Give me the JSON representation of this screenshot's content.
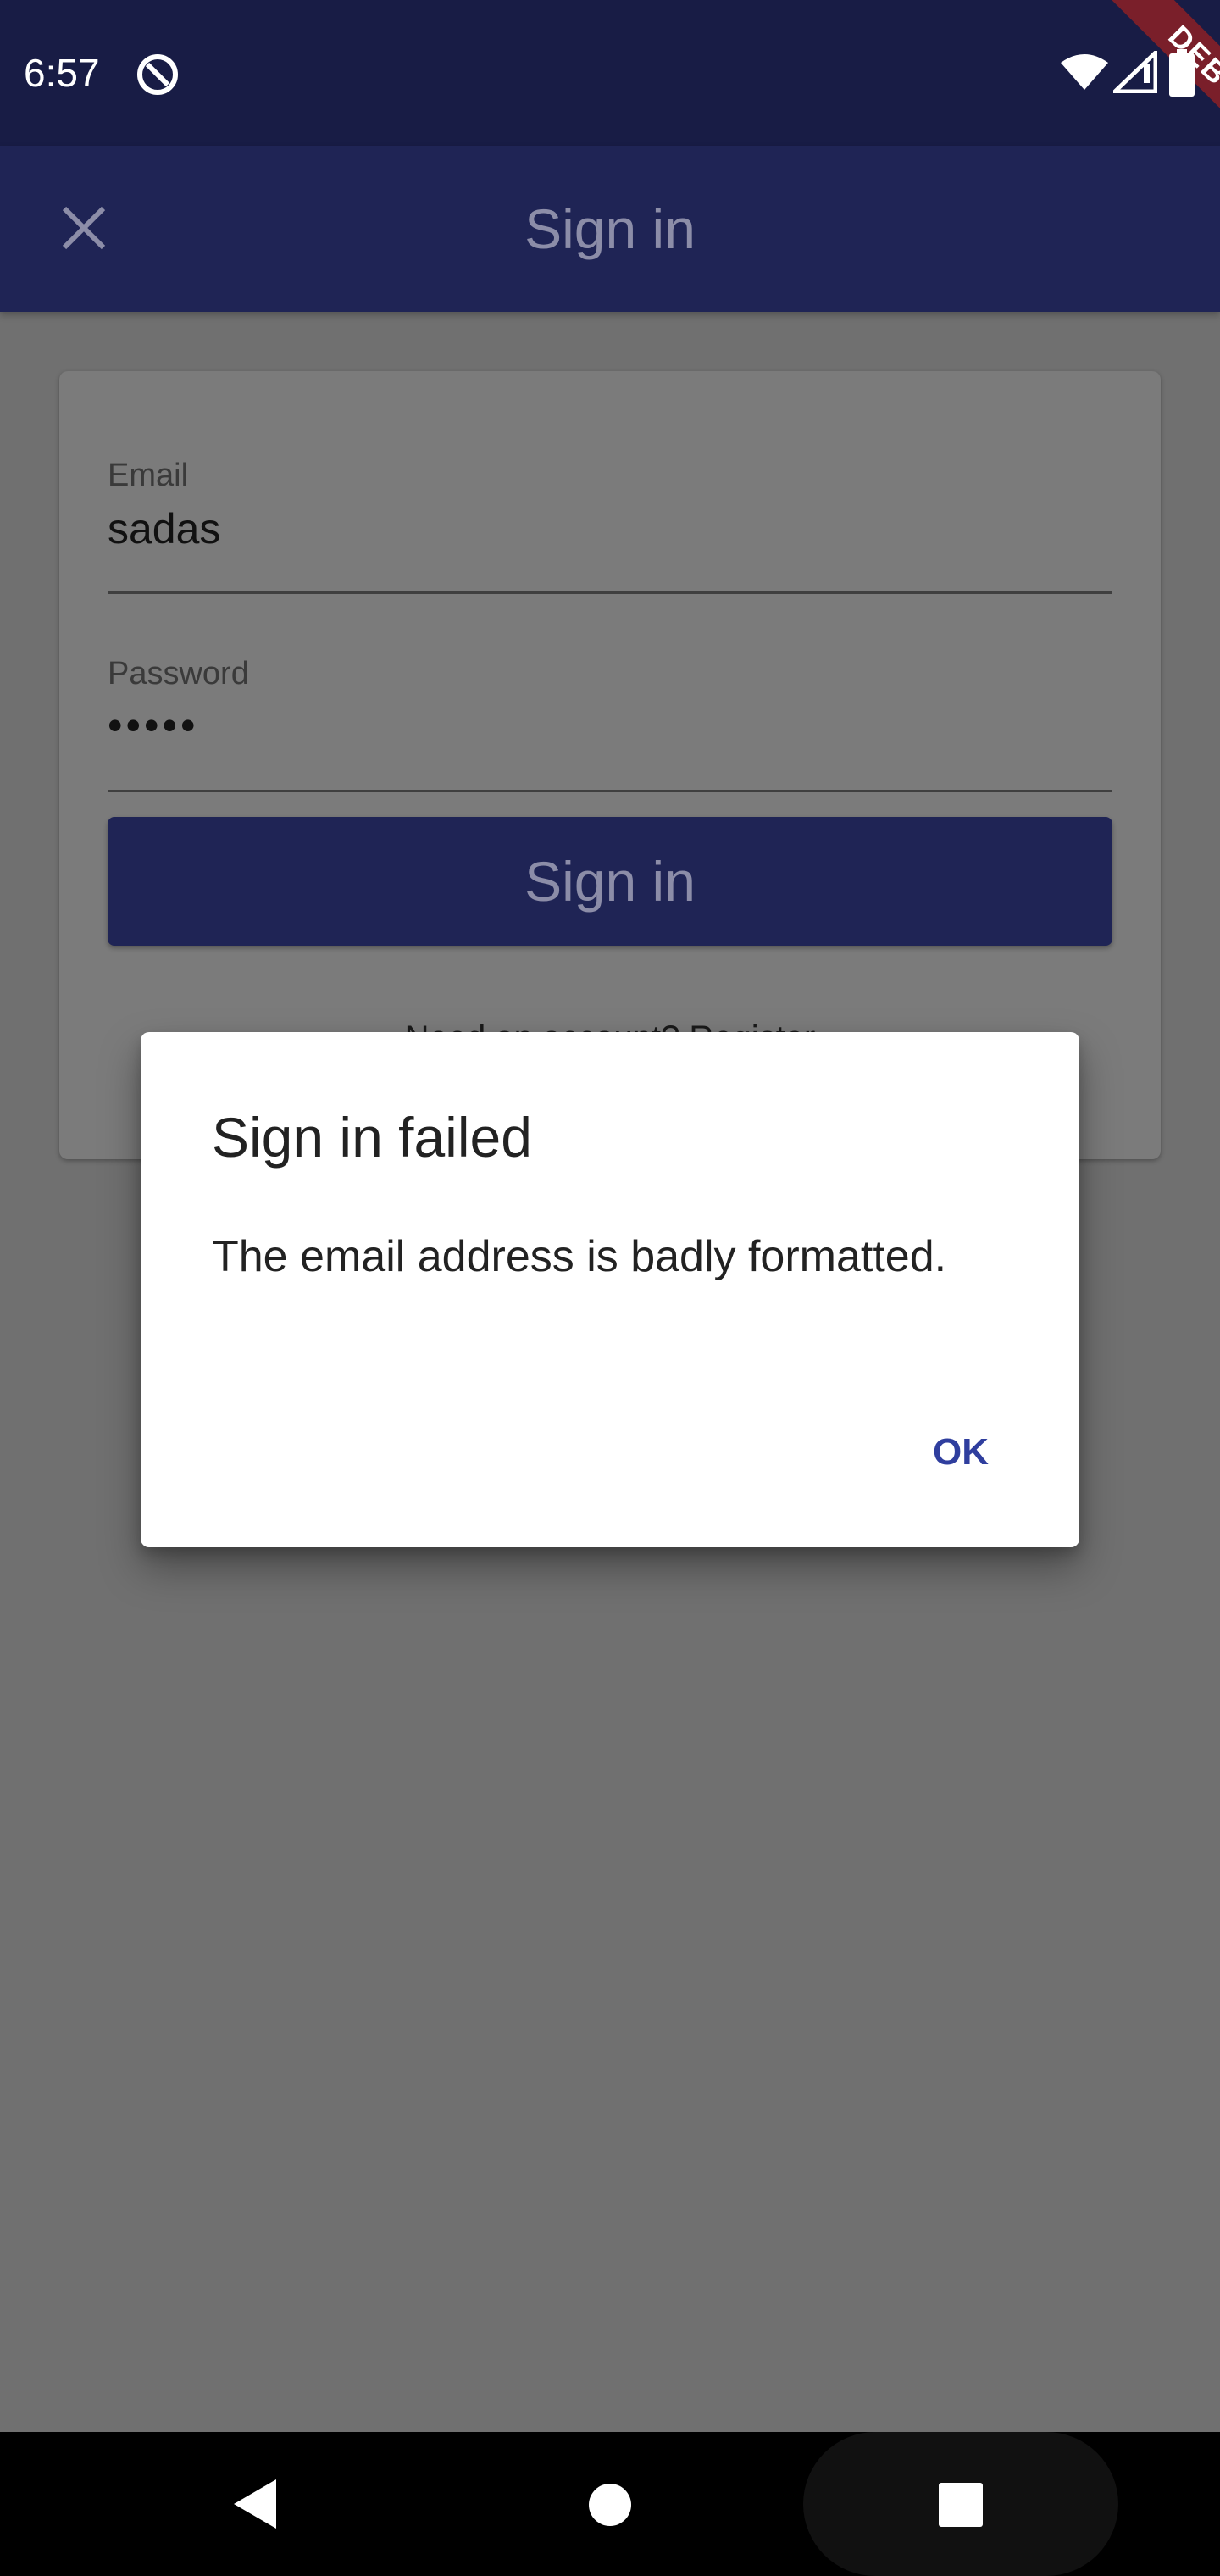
{
  "status_bar": {
    "time": "6:57",
    "debug_banner": "DEBUG",
    "icons": [
      "data-saver-icon",
      "wifi-icon",
      "signal-icon",
      "battery-icon"
    ]
  },
  "app_bar": {
    "title": "Sign in",
    "close_icon": "close-icon",
    "background": "#1f2455"
  },
  "login_form": {
    "email_label": "Email",
    "email_value": "sadas",
    "password_label": "Password",
    "password_value": "•••••",
    "submit_label": "Sign in",
    "register_text": "Need an account? Register"
  },
  "dialog": {
    "title": "Sign in failed",
    "message": "The email address is badly formatted.",
    "ok_label": "OK",
    "accent": "#2f3e9e"
  },
  "nav_bar": {
    "back_icon": "back-icon",
    "home_icon": "home-icon",
    "recents_icon": "recents-icon"
  }
}
